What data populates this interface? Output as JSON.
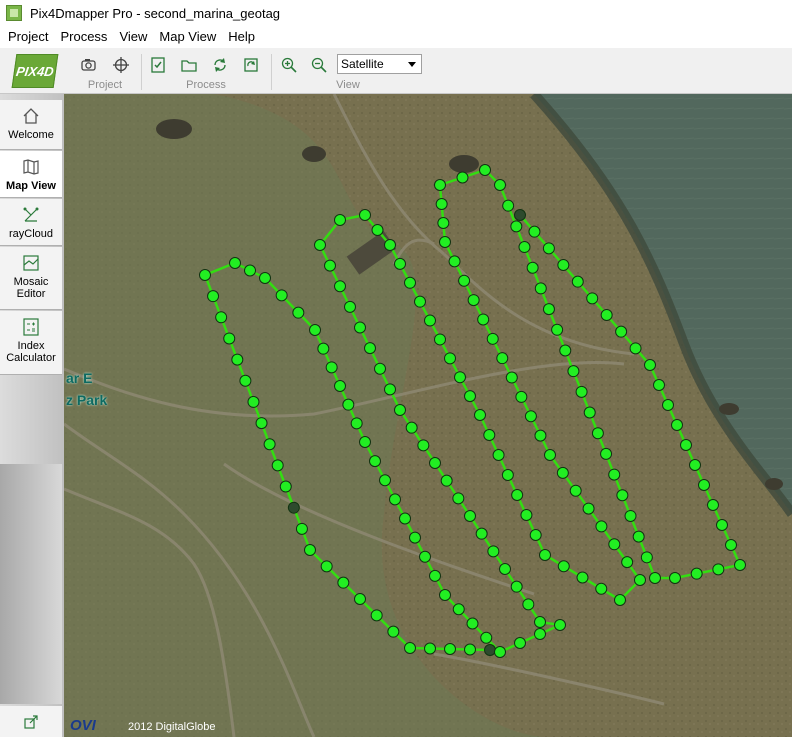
{
  "window": {
    "title": "Pix4Dmapper Pro - second_marina_geotag"
  },
  "menu": [
    "Project",
    "Process",
    "View",
    "Map View",
    "Help"
  ],
  "toolbar": {
    "logo": "PIX4D",
    "groups": [
      {
        "label": "Project",
        "buttons": [
          "camera-icon",
          "gps-target-icon"
        ]
      },
      {
        "label": "Process",
        "buttons": [
          "checklist-icon",
          "open-folder-icon",
          "reprocess-icon",
          "reoptimize-icon"
        ]
      },
      {
        "label": "View",
        "buttons": [
          "zoom-in-icon",
          "zoom-out-icon"
        ]
      }
    ],
    "basemap_select": "Satellite"
  },
  "sidebar": {
    "items": [
      {
        "label": "Welcome",
        "icon": "home-icon",
        "active": false
      },
      {
        "label": "Map View",
        "icon": "map-icon",
        "active": true
      },
      {
        "label": "rayCloud",
        "icon": "raycloud-icon",
        "active": false
      },
      {
        "label": "Mosaic Editor",
        "icon": "mosaic-icon",
        "active": false
      },
      {
        "label": "Index Calculator",
        "icon": "calculator-icon",
        "active": false
      }
    ],
    "bottom_icon": "export-icon"
  },
  "map": {
    "labels": [
      "ar E",
      "z Park"
    ],
    "attribution": "OVI",
    "copyright": "2012 DigitalGlobe",
    "colors": {
      "water": "#52685d",
      "land": "#7a7356",
      "flight_line": "#33dd11",
      "point": "#22ee22",
      "point_dark": "#2d4a2d"
    }
  }
}
